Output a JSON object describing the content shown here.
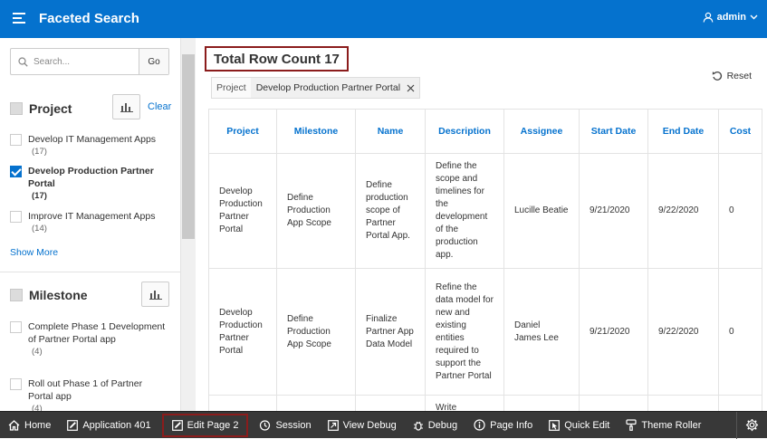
{
  "header": {
    "title": "Faceted Search",
    "user": "admin"
  },
  "search": {
    "placeholder": "Search...",
    "go_label": "Go"
  },
  "facets": {
    "project": {
      "title": "Project",
      "clear_label": "Clear",
      "options": [
        {
          "label": "Develop IT Management Apps",
          "count": "(17)",
          "checked": false
        },
        {
          "label": "Develop Production Partner Portal",
          "count": "(17)",
          "checked": true
        },
        {
          "label": "Improve IT Management Apps",
          "count": "(14)",
          "checked": false
        }
      ],
      "show_more": "Show More"
    },
    "milestone": {
      "title": "Milestone",
      "options": [
        {
          "label": "Complete Phase 1 Development of Partner Portal app",
          "count": "(4)",
          "checked": false
        },
        {
          "label": "Roll out Phase 1 of Partner Portal app",
          "count": "(4)",
          "checked": false
        }
      ]
    }
  },
  "main": {
    "row_count": "Total Row Count 17",
    "reset_label": "Reset",
    "filter_chip": {
      "key": "Project",
      "value": "Develop Production Partner Portal"
    }
  },
  "table": {
    "columns": [
      "Project",
      "Milestone",
      "Name",
      "Description",
      "Assignee",
      "Start Date",
      "End Date",
      "Cost"
    ],
    "rows": [
      [
        "Develop Production Partner Portal",
        "Define Production App Scope",
        "Define production scope of Partner Portal App.",
        "Define the scope and timelines for the development of the production app.",
        "Lucille Beatie",
        "9/21/2020",
        "9/22/2020",
        "0"
      ],
      [
        "Develop Production Partner Portal",
        "Define Production App Scope",
        "Finalize Partner App Data Model",
        "Refine the data model for new and existing entities required to support the Partner Portal",
        "Daniel James Lee",
        "9/21/2020",
        "9/22/2020",
        "0"
      ],
      [
        "",
        "",
        "",
        "Write",
        "",
        "",
        "",
        ""
      ]
    ]
  },
  "devbar": {
    "items": [
      {
        "label": "Home",
        "icon": "home-icon"
      },
      {
        "label": "Application 401",
        "icon": "edit-icon"
      },
      {
        "label": "Edit Page 2",
        "icon": "edit-icon"
      },
      {
        "label": "Session",
        "icon": "session-icon"
      },
      {
        "label": "View Debug",
        "icon": "view-debug-icon"
      },
      {
        "label": "Debug",
        "icon": "bug-icon"
      },
      {
        "label": "Page Info",
        "icon": "info-icon"
      },
      {
        "label": "Quick Edit",
        "icon": "quick-edit-icon"
      },
      {
        "label": "Theme Roller",
        "icon": "brush-icon"
      }
    ]
  },
  "colors": {
    "accent": "#0572ce",
    "highlight": "#8b1c1c",
    "devbar": "#383838"
  }
}
